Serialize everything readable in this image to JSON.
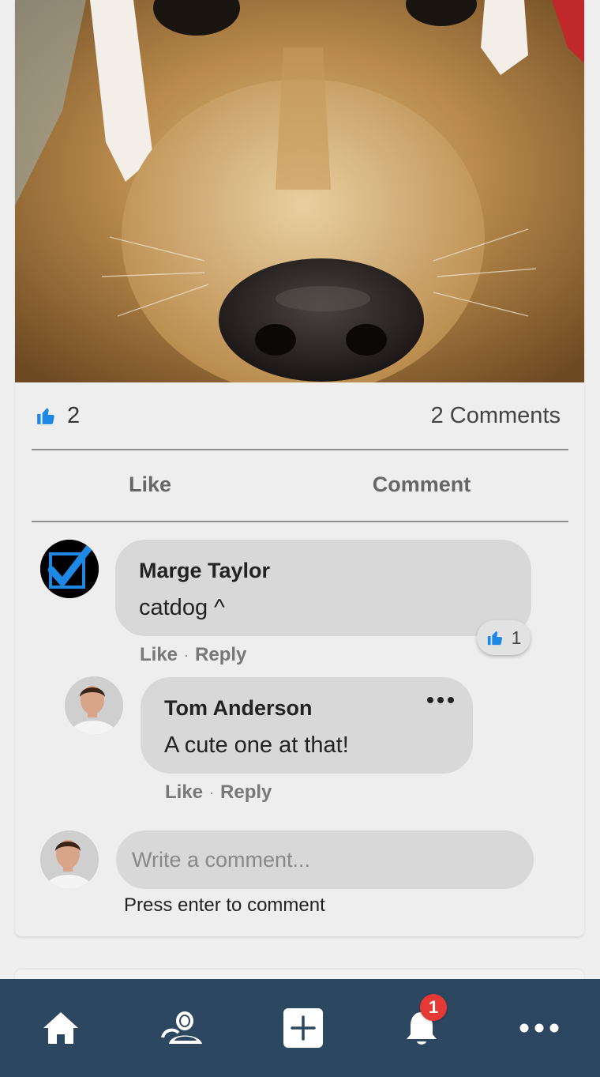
{
  "post": {
    "like_count": "2",
    "comment_count": "2 Comments",
    "actions": {
      "like": "Like",
      "comment": "Comment"
    }
  },
  "comments": [
    {
      "author": "Marge Taylor",
      "text": "catdog ^",
      "like_label": "Like",
      "separator": "·",
      "reply_label": "Reply",
      "reaction_count": "1"
    },
    {
      "author": "Tom Anderson",
      "text": "A cute one at that!",
      "like_label": "Like",
      "separator": "·",
      "reply_label": "Reply"
    }
  ],
  "composer": {
    "placeholder": "Write a comment...",
    "hint": "Press enter to comment"
  },
  "nav": {
    "notification_badge": "1",
    "items": [
      "home-icon",
      "friends-icon",
      "add-post-icon",
      "notifications-icon",
      "more-icon"
    ]
  },
  "colors": {
    "accent": "#1e88e5",
    "nav_bg": "#2d4760",
    "badge": "#e53935"
  }
}
